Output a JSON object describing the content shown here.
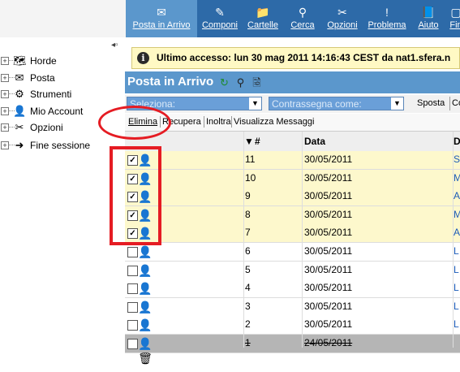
{
  "toolbar": {
    "items": [
      {
        "label": "Posta in Arrivo",
        "icon": "envelope-icon",
        "glyph": "✉"
      },
      {
        "label": "Componi",
        "icon": "compose-icon",
        "glyph": "✎"
      },
      {
        "label": "Cartelle",
        "icon": "folder-icon",
        "glyph": "📁"
      },
      {
        "label": "Cerca",
        "icon": "search-icon",
        "glyph": "⚲"
      },
      {
        "label": "Opzioni",
        "icon": "tools-icon",
        "glyph": "✂"
      },
      {
        "label": "Problema",
        "icon": "warning-icon",
        "glyph": "!"
      },
      {
        "label": "Aiuto",
        "icon": "help-book-icon",
        "glyph": "📘"
      },
      {
        "label": "Fin",
        "icon": "exit-icon",
        "glyph": "▢"
      }
    ],
    "active_index": 0
  },
  "sidebar": {
    "items": [
      {
        "label": "Horde",
        "icon": "horde-icon",
        "glyph": "🗺"
      },
      {
        "label": "Posta",
        "icon": "mail-icon",
        "glyph": "✉"
      },
      {
        "label": "Strumenti",
        "icon": "gear-icon",
        "glyph": "⚙"
      },
      {
        "label": "Mio Account",
        "icon": "user-icon",
        "glyph": "👤"
      },
      {
        "label": "Opzioni",
        "icon": "tools-icon",
        "glyph": "✂"
      },
      {
        "label": "Fine sessione",
        "icon": "logout-icon",
        "glyph": "➜"
      }
    ],
    "expand_marker": "+"
  },
  "info": {
    "icon_glyph": "i",
    "text": "Ultimo accesso: lun 30 mag 2011 14:16:43 CEST da nat1.sfera.n"
  },
  "mailbox": {
    "title": "Posta in Arrivo",
    "title_icons": [
      {
        "name": "refresh-icon",
        "glyph": "↻"
      },
      {
        "name": "search-icon",
        "glyph": "⚲"
      },
      {
        "name": "filter-icon",
        "glyph": "🗟"
      }
    ]
  },
  "selectors": {
    "seleziona": "Seleziona:",
    "contrassegna": "Contrassegna come:",
    "sposta": "Sposta",
    "copia": "Co"
  },
  "actions": [
    "Elimina",
    "Recupera",
    "Inoltra",
    "Visualizza Messaggi"
  ],
  "table": {
    "headers": {
      "sort_marker": "▼",
      "num": "#",
      "date": "Data",
      "from": "D"
    },
    "rows": [
      {
        "checked": true,
        "num": "11",
        "date": "30/05/2011",
        "from": "S",
        "highlight": true,
        "deleted": false
      },
      {
        "checked": true,
        "num": "10",
        "date": "30/05/2011",
        "from": "M",
        "highlight": true,
        "deleted": false
      },
      {
        "checked": true,
        "num": "9",
        "date": "30/05/2011",
        "from": "A",
        "highlight": true,
        "deleted": false
      },
      {
        "checked": true,
        "num": "8",
        "date": "30/05/2011",
        "from": "M",
        "highlight": true,
        "deleted": false
      },
      {
        "checked": true,
        "num": "7",
        "date": "30/05/2011",
        "from": "A",
        "highlight": true,
        "deleted": false
      },
      {
        "checked": false,
        "num": "6",
        "date": "30/05/2011",
        "from": "L",
        "highlight": false,
        "deleted": false
      },
      {
        "checked": false,
        "num": "5",
        "date": "30/05/2011",
        "from": "L",
        "highlight": false,
        "deleted": false
      },
      {
        "checked": false,
        "num": "4",
        "date": "30/05/2011",
        "from": "L",
        "highlight": false,
        "deleted": false
      },
      {
        "checked": false,
        "num": "3",
        "date": "30/05/2011",
        "from": "L",
        "highlight": false,
        "deleted": false
      },
      {
        "checked": false,
        "num": "2",
        "date": "30/05/2011",
        "from": "L",
        "highlight": false,
        "deleted": false
      },
      {
        "checked": false,
        "num": "1",
        "date": "24/05/2011",
        "from": "",
        "highlight": false,
        "deleted": true
      }
    ]
  },
  "colors": {
    "toolbar_bg": "#2d6aa8",
    "toolbar_active": "#5b97cc",
    "title_bg": "#5b97cc",
    "row_highlight": "#fdf8cc",
    "row_deleted": "#b5b5b5",
    "annotation_red": "#e51c23",
    "link_blue": "#1a5ab8"
  }
}
